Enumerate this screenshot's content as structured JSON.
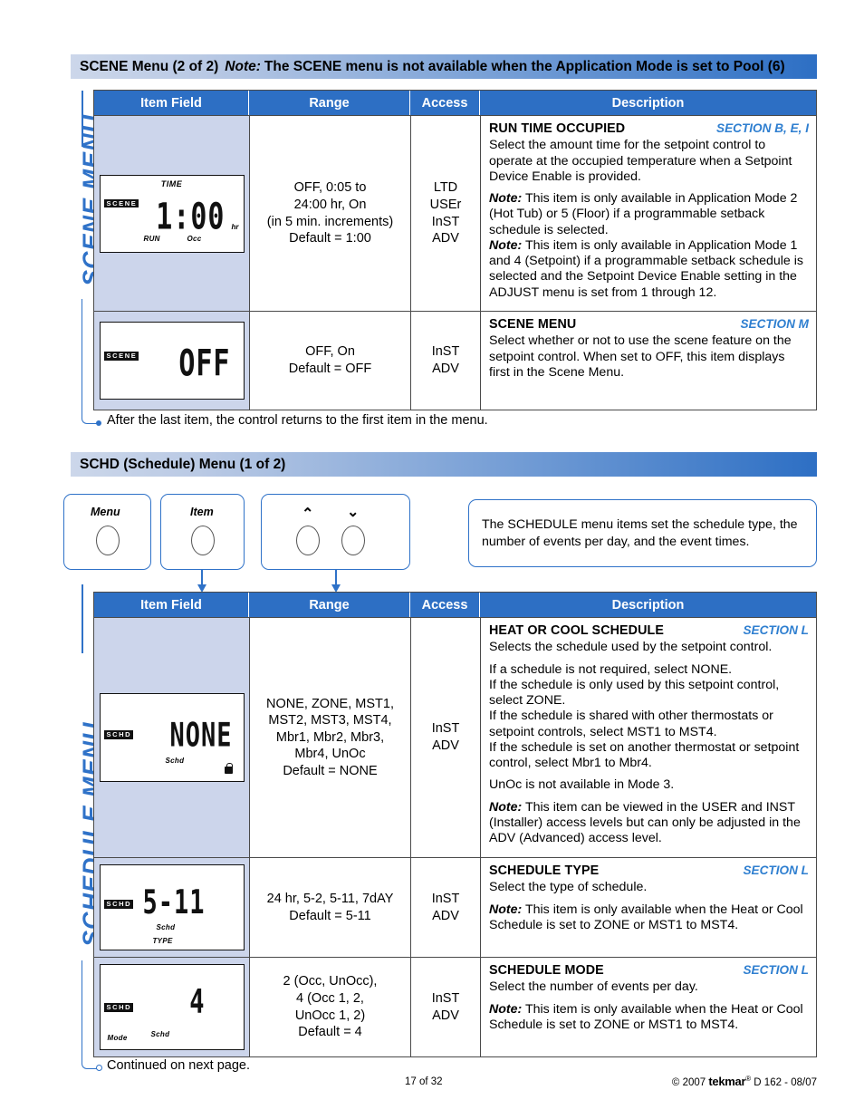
{
  "scene_section": {
    "banner_title": "SCENE Menu (2 of 2)",
    "banner_note_label": "Note:",
    "banner_note_text": "The SCENE menu is not available when the Application Mode is set to Pool (6)",
    "vertical_label": "SCENE MENU",
    "footnote": "After the last item, the control returns to the first item in the menu.",
    "columns": [
      "Item Field",
      "Range",
      "Access",
      "Description"
    ],
    "rows": [
      {
        "lcd": {
          "badge": "SCENE",
          "top_label": "TIME",
          "value": "1:00",
          "unit": "hr",
          "labels": [
            "RUN",
            "Occ"
          ]
        },
        "range": "OFF, 0:05 to\n24:00 hr, On\n(in 5 min. increments)\nDefault = 1:00",
        "access": "LTD\nUSEr\nInST\nADV",
        "title": "RUN TIME OCCUPIED",
        "section": "SECTION B, E, I",
        "body": [
          "Select the amount time for the setpoint control to operate at the occupied temperature when a Setpoint Device Enable is provided.",
          "This item is only available in Application Mode 2 (Hot Tub) or 5 (Floor) if a programmable setback schedule is selected.",
          "This item is only available in Application Mode 1 and 4 (Setpoint) if a programmable setback schedule is selected and the Setpoint Device Enable setting in the ADJUST menu is set from 1 through 12."
        ],
        "note_flags": [
          false,
          true,
          true
        ],
        "note_label": "Note:"
      },
      {
        "lcd": {
          "badge": "SCENE",
          "top_label": "",
          "value": "OFF",
          "unit": "",
          "labels": []
        },
        "range": "OFF, On\nDefault = OFF",
        "access": "InST\nADV",
        "title": "SCENE MENU",
        "section": "SECTION M",
        "body": [
          "Select whether or not to use the scene feature on the setpoint control. When set to OFF, this item displays first in the Scene Menu."
        ],
        "note_flags": [
          false
        ],
        "note_label": "Note:"
      }
    ]
  },
  "schedule_section": {
    "banner_title": "SCHD (Schedule) Menu (1 of 2)",
    "vertical_label": "SCHEDULE MENU",
    "footnote": "Continued on next page.",
    "buttons": [
      {
        "label": "Menu",
        "type": "single"
      },
      {
        "label": "Item",
        "type": "single"
      },
      {
        "label": "",
        "type": "updown",
        "up_glyph": "⌃",
        "down_glyph": "⌄"
      }
    ],
    "info_text": "The SCHEDULE menu items set the schedule type, the number of events per day, and the event times.",
    "columns": [
      "Item Field",
      "Range",
      "Access",
      "Description"
    ],
    "rows": [
      {
        "lcd": {
          "badge": "SCHD",
          "top_label": "",
          "value": "NONE",
          "unit": "",
          "labels": [
            "Schd"
          ],
          "lock": true
        },
        "range": "NONE, ZONE, MST1,\nMST2, MST3, MST4,\nMbr1, Mbr2, Mbr3,\nMbr4, UnOc\nDefault = NONE",
        "access": "InST\nADV",
        "title": "HEAT OR COOL SCHEDULE",
        "section": "SECTION L",
        "body": [
          "Selects the schedule used by the setpoint control.",
          "If a schedule is not required, select NONE.",
          "If the schedule is only used by this setpoint control, select ZONE.",
          "If the schedule is shared with other thermostats or setpoint controls, select MST1 to MST4.",
          "If the schedule is set on another thermostat or setpoint control, select Mbr1 to Mbr4.",
          "UnOc is not available in Mode 3.",
          "This item can be viewed in the USER and INST (Installer) access levels but can only be adjusted in the ADV (Advanced) access level."
        ],
        "note_flags": [
          false,
          false,
          false,
          false,
          false,
          false,
          true
        ],
        "note_label": "Note:"
      },
      {
        "lcd": {
          "badge": "SCHD",
          "top_label": "",
          "value": "5-11",
          "unit": "",
          "labels": [
            "Schd",
            "TYPE"
          ]
        },
        "range": "24 hr, 5-2, 5-11, 7dAY\nDefault = 5-11",
        "access": "InST\nADV",
        "title": "SCHEDULE TYPE",
        "section": "SECTION L",
        "body": [
          "Select the type of schedule.",
          "This item is only available when the Heat or Cool Schedule is set to ZONE or MST1 to MST4."
        ],
        "note_flags": [
          false,
          true
        ],
        "note_label": "Note:"
      },
      {
        "lcd": {
          "badge": "SCHD",
          "top_label": "",
          "value": "4",
          "unit": "",
          "labels": [
            "Mode",
            "Schd"
          ]
        },
        "range": "2 (Occ, UnOcc),\n4 (Occ 1, 2,\nUnOcc 1, 2)\nDefault = 4",
        "access": "InST\nADV",
        "title": "SCHEDULE MODE",
        "section": "SECTION L",
        "body": [
          "Select the number of events per day.",
          "This item is only available when the Heat or Cool Schedule is set to ZONE or MST1 to MST4."
        ],
        "note_flags": [
          false,
          true
        ],
        "note_label": "Note:"
      }
    ]
  },
  "footer": {
    "page": "17 of 32",
    "copyright_pre": "© 2007 ",
    "brand": "tekmar",
    "brand_sup": "®",
    "copyright_post": " D 162 - 08/07"
  },
  "colors": {
    "accent_blue": "#2d6fc4",
    "row_bg": "#ccd5eb",
    "section_link": "#2f7fd0"
  }
}
